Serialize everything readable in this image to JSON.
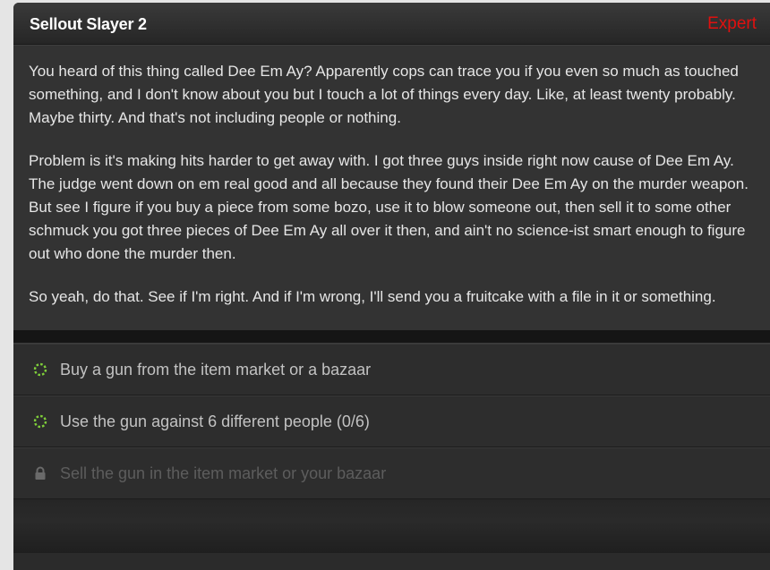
{
  "mission": {
    "title": "Sellout Slayer 2",
    "difficulty": "Expert",
    "difficulty_color": "#e0100f"
  },
  "description": [
    "You heard of this thing called Dee Em Ay? Apparently cops can trace you if you even so much as touched something, and I don't know about you but I touch a lot of things every day. Like, at least twenty probably. Maybe thirty. And that's not including people or nothing.",
    "Problem is it's making hits harder to get away with. I got three guys inside right now cause of Dee Em Ay. The judge went down on em real good and all because they found their Dee Em Ay on the murder weapon. But see I figure if you buy a piece from some bozo, use it to blow someone out, then sell it to some other schmuck you got three pieces of Dee Em Ay all over it then, and ain't no science-ist smart enough to figure out who done the murder then.",
    "So yeah, do that. See if I'm right. And if I'm wrong, I'll send you a fruitcake with a file in it or something."
  ],
  "tasks": [
    {
      "label": "Buy a gun from the item market or a bazaar",
      "icon": "progress-ring-icon",
      "state": "in-progress"
    },
    {
      "label": "Use the gun against 6 different people (0/6)",
      "icon": "progress-ring-icon",
      "state": "in-progress"
    },
    {
      "label": "Sell the gun in the item market or your bazaar",
      "icon": "lock-icon",
      "state": "locked"
    }
  ],
  "colors": {
    "progress_icon": "#7fcf3a",
    "lock_icon": "#6a6a6a"
  }
}
